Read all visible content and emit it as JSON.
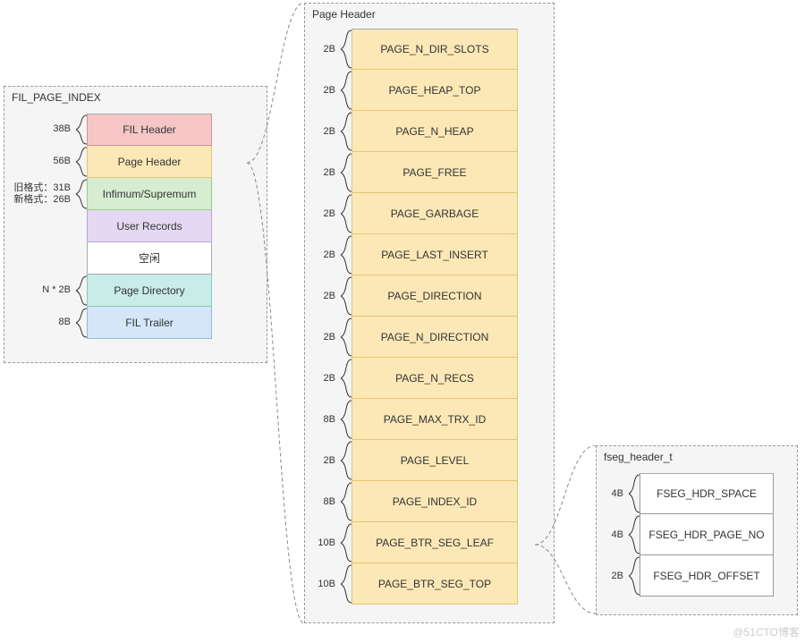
{
  "watermark": "@51CTO博客",
  "left": {
    "title": "FIL_PAGE_INDEX",
    "rows": [
      {
        "size": "38B",
        "label": "FIL Header",
        "cls": "c-red"
      },
      {
        "size": "56B",
        "label": "Page Header",
        "cls": "c-orange"
      },
      {
        "size": "旧格式：31B\n新格式：26B",
        "label": "Infimum/Supremum",
        "cls": "c-green"
      },
      {
        "size": "",
        "label": "User Records",
        "cls": "c-purple"
      },
      {
        "size": "",
        "label": "空闲",
        "cls": "c-white"
      },
      {
        "size": "N * 2B",
        "label": "Page Directory",
        "cls": "c-teal"
      },
      {
        "size": "8B",
        "label": "FIL Trailer",
        "cls": "c-blue"
      }
    ]
  },
  "middle": {
    "title": "Page Header",
    "rows": [
      {
        "size": "2B",
        "label": "PAGE_N_DIR_SLOTS"
      },
      {
        "size": "2B",
        "label": "PAGE_HEAP_TOP"
      },
      {
        "size": "2B",
        "label": "PAGE_N_HEAP"
      },
      {
        "size": "2B",
        "label": "PAGE_FREE"
      },
      {
        "size": "2B",
        "label": "PAGE_GARBAGE"
      },
      {
        "size": "2B",
        "label": "PAGE_LAST_INSERT"
      },
      {
        "size": "2B",
        "label": "PAGE_DIRECTION"
      },
      {
        "size": "2B",
        "label": "PAGE_N_DIRECTION"
      },
      {
        "size": "2B",
        "label": "PAGE_N_RECS"
      },
      {
        "size": "8B",
        "label": "PAGE_MAX_TRX_ID"
      },
      {
        "size": "2B",
        "label": "PAGE_LEVEL"
      },
      {
        "size": "8B",
        "label": "PAGE_INDEX_ID"
      },
      {
        "size": "10B",
        "label": "PAGE_BTR_SEG_LEAF"
      },
      {
        "size": "10B",
        "label": "PAGE_BTR_SEG_TOP"
      }
    ]
  },
  "right": {
    "title": "fseg_header_t",
    "rows": [
      {
        "size": "4B",
        "label": "FSEG_HDR_SPACE"
      },
      {
        "size": "4B",
        "label": "FSEG_HDR_PAGE_NO"
      },
      {
        "size": "2B",
        "label": "FSEG_HDR_OFFSET"
      }
    ]
  }
}
